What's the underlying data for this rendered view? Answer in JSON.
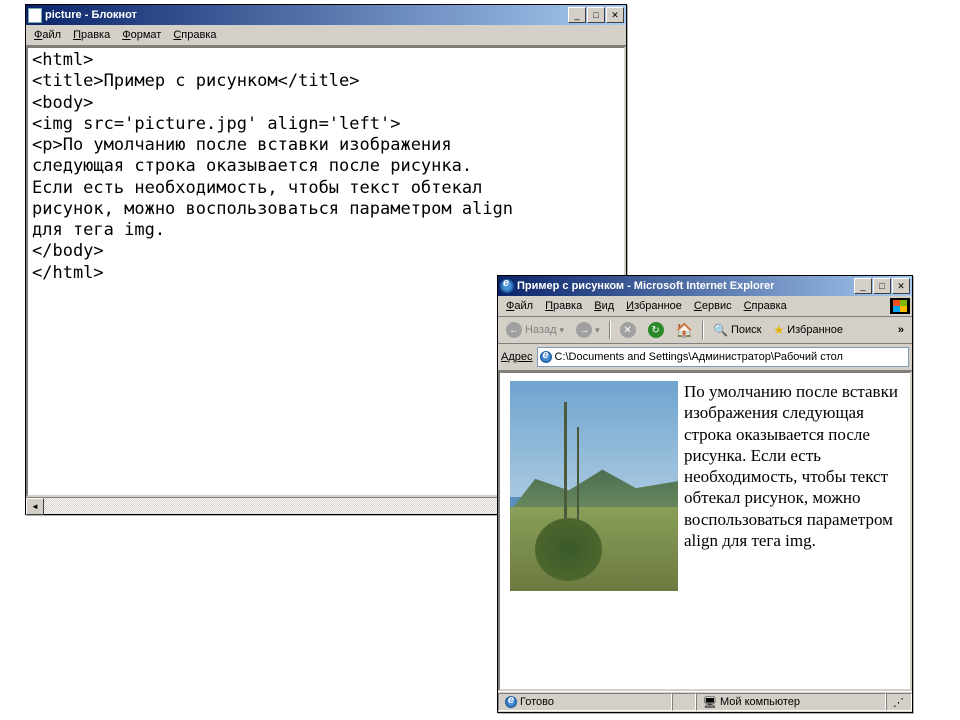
{
  "notepad": {
    "title": "picture - Блокнот",
    "menu": [
      "Файл",
      "Правка",
      "Формат",
      "Справка"
    ],
    "content": "<html>\n<title>Пример с рисунком</title>\n<body>\n<img src='picture.jpg' align='left'>\n<p>По умолчанию после вставки изображения\nследующая строка оказывается после рисунка.\nЕсли есть необходимость, чтобы текст обтекал\nрисунок, можно воспользоваться параметром align\nдля тега img.\n</body>\n</html>"
  },
  "ie": {
    "title": "Пример с рисунком - Microsoft Internet Explorer",
    "menu": [
      "Файл",
      "Правка",
      "Вид",
      "Избранное",
      "Сервис",
      "Справка"
    ],
    "toolbar": {
      "back": "Назад",
      "search": "Поиск",
      "favorites": "Избранное",
      "expand": "»"
    },
    "address_label": "Адрес",
    "address_value": "C:\\Documents and Settings\\Администратор\\Рабочий стол",
    "body_text": "По умолчанию после вставки изображения следующая строка оказывается после рисунка. Если есть необходимость, чтобы текст обтекал рисунок, можно воспользоваться параметром align для тега img.",
    "status_done": "Готово",
    "status_zone": "Мой компьютер"
  },
  "winbtns": {
    "min": "_",
    "max": "□",
    "close": "✕"
  }
}
